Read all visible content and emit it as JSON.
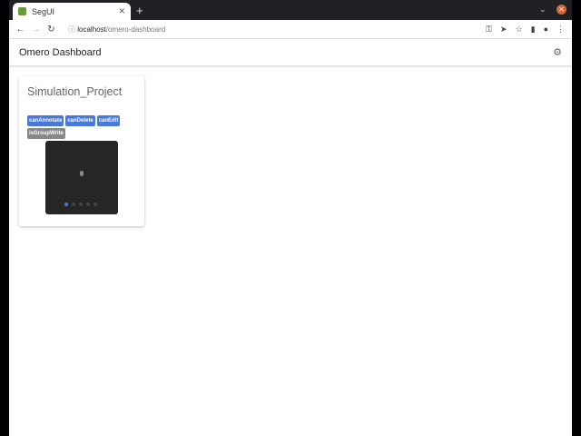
{
  "browser": {
    "tab_title": "SegUI",
    "url_host": "localhost",
    "url_path": "/omero-dashboard"
  },
  "header": {
    "title": "Omero Dashboard"
  },
  "project": {
    "name": "Simulation_Project",
    "badges": [
      {
        "label": "canAnnotate",
        "color": "#4a78d6"
      },
      {
        "label": "canDelete",
        "color": "#4a78d6"
      },
      {
        "label": "canEdit",
        "color": "#4a78d6"
      },
      {
        "label": "isGroupWrite",
        "color": "#888888"
      }
    ],
    "carousel": {
      "slides": 5,
      "active": 1
    }
  }
}
